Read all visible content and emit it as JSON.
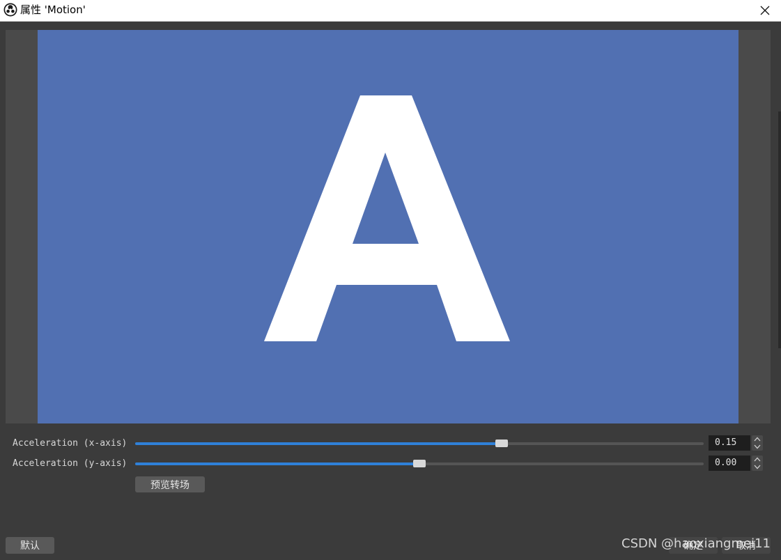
{
  "window": {
    "title": "属性 'Motion'",
    "app_icon": "obs-logo-icon",
    "close_icon": "close-icon"
  },
  "preview": {
    "glyph": "A",
    "canvas_color": "#5170b2",
    "border_color": "#4a4a4a",
    "glyph_color": "#ffffff"
  },
  "properties": [
    {
      "label": "Acceleration (x-axis)",
      "value": "0.15",
      "slider_fraction": 0.645
    },
    {
      "label": "Acceleration (y-axis)",
      "value": "0.00",
      "slider_fraction": 0.5
    }
  ],
  "buttons": {
    "preview_transition": "预览转场",
    "defaults": "默认",
    "ok": "确定",
    "cancel": "取消"
  },
  "watermark": "CSDN @haoxiangmei11",
  "colors": {
    "accent": "#2f80d8",
    "background": "#3b3b3b",
    "button": "#595959"
  }
}
